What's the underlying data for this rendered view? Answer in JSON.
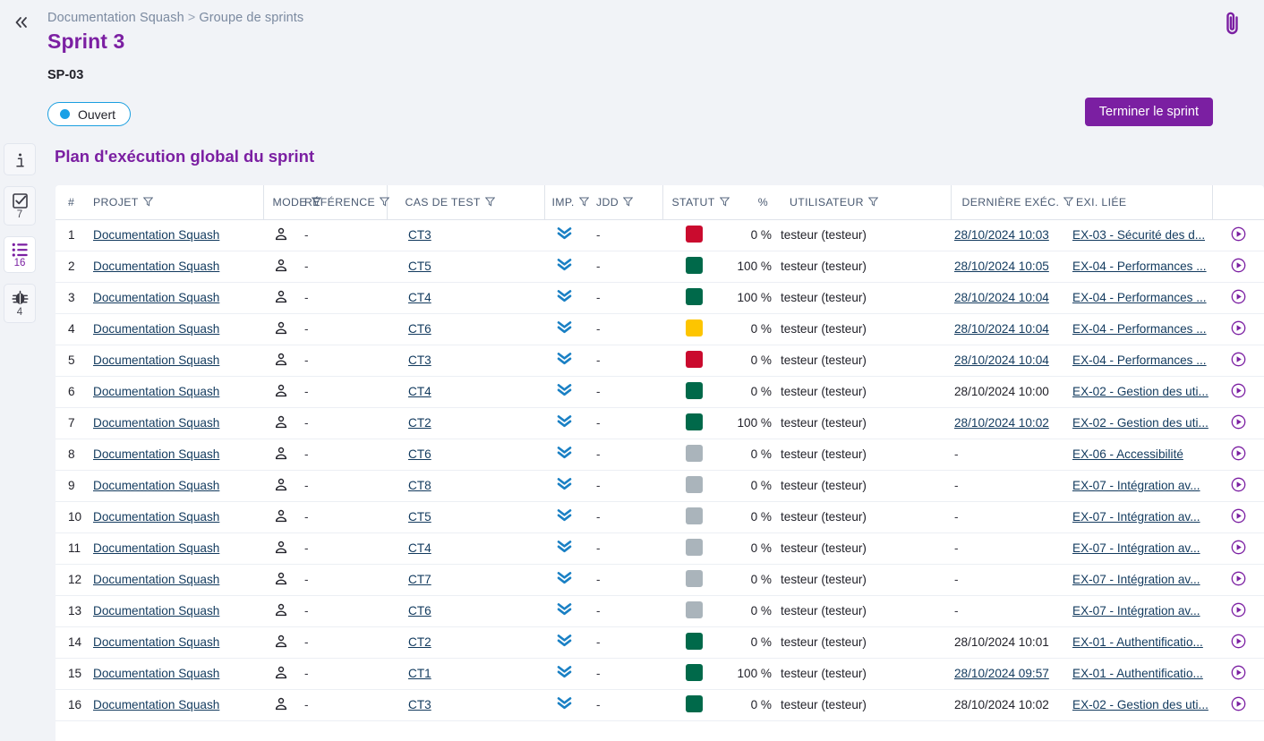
{
  "header": {
    "collapse_icon": "chevron-double-left-icon",
    "attachment_icon": "paperclip-icon",
    "breadcrumb_root": "Documentation Squash",
    "breadcrumb_separator": ">",
    "breadcrumb_leaf": "Groupe de sprints",
    "title": "Sprint 3",
    "reference": "SP-03",
    "status_label": "Ouvert",
    "status_color": "#1aa0e6",
    "primary_button": "Terminer le sprint",
    "primary_color": "#7b1fa2"
  },
  "rail": {
    "items": [
      {
        "name": "info-icon",
        "icon": "info-icon",
        "count": ""
      },
      {
        "name": "checkbox-icon",
        "icon": "check-square-icon",
        "count": "7"
      },
      {
        "name": "list-icon",
        "icon": "list-icon",
        "count": "16",
        "active": true
      },
      {
        "name": "bug-icon",
        "icon": "bug-icon",
        "count": "4"
      }
    ]
  },
  "main": {
    "section_title": "Plan d'exécution global du sprint",
    "columns": [
      {
        "key": "num",
        "label": "#",
        "filter": false
      },
      {
        "key": "proj",
        "label": "PROJET",
        "filter": true
      },
      {
        "key": "mode",
        "label": "MODE",
        "filter": true
      },
      {
        "key": "ref",
        "label": "RÉFÉRENCE",
        "filter": true
      },
      {
        "key": "ct",
        "label": "CAS DE TEST",
        "filter": true
      },
      {
        "key": "imp",
        "label": "IMP.",
        "filter": true
      },
      {
        "key": "jdd",
        "label": "JDD",
        "filter": true
      },
      {
        "key": "stat",
        "label": "STATUT",
        "filter": true
      },
      {
        "key": "pct",
        "label": "%",
        "filter": false
      },
      {
        "key": "user",
        "label": "UTILISATEUR",
        "filter": true
      },
      {
        "key": "exec",
        "label": "DERNIÈRE EXÉC.",
        "filter": true
      },
      {
        "key": "exi",
        "label": "EXI. LIÉE",
        "filter": false
      }
    ],
    "rows": [
      {
        "num": "1",
        "projet": "Documentation Squash",
        "mode": "manual",
        "reference": "-",
        "cas_de_test": "CT3",
        "importance": "low",
        "jdd": "-",
        "statut": "red",
        "pct": "0 %",
        "utilisateur": "testeur (testeur)",
        "derniere_exec": "28/10/2024 10:03",
        "exec_link": true,
        "exigence": "EX-03 - Sécurité des d...",
        "action": "play"
      },
      {
        "num": "2",
        "projet": "Documentation Squash",
        "mode": "manual",
        "reference": "-",
        "cas_de_test": "CT5",
        "importance": "low",
        "jdd": "-",
        "statut": "green",
        "pct": "100 %",
        "utilisateur": "testeur (testeur)",
        "derniere_exec": "28/10/2024 10:05",
        "exec_link": true,
        "exigence": "EX-04 - Performances ...",
        "action": "play"
      },
      {
        "num": "3",
        "projet": "Documentation Squash",
        "mode": "manual",
        "reference": "-",
        "cas_de_test": "CT4",
        "importance": "low",
        "jdd": "-",
        "statut": "green",
        "pct": "100 %",
        "utilisateur": "testeur (testeur)",
        "derniere_exec": "28/10/2024 10:04",
        "exec_link": true,
        "exigence": "EX-04 - Performances ...",
        "action": "play"
      },
      {
        "num": "4",
        "projet": "Documentation Squash",
        "mode": "manual",
        "reference": "-",
        "cas_de_test": "CT6",
        "importance": "low",
        "jdd": "-",
        "statut": "yellow",
        "pct": "0 %",
        "utilisateur": "testeur (testeur)",
        "derniere_exec": "28/10/2024 10:04",
        "exec_link": true,
        "exigence": "EX-04 - Performances ...",
        "action": "play"
      },
      {
        "num": "5",
        "projet": "Documentation Squash",
        "mode": "manual",
        "reference": "-",
        "cas_de_test": "CT3",
        "importance": "low",
        "jdd": "-",
        "statut": "red",
        "pct": "0 %",
        "utilisateur": "testeur (testeur)",
        "derniere_exec": "28/10/2024 10:04",
        "exec_link": true,
        "exigence": "EX-04 - Performances ...",
        "action": "play"
      },
      {
        "num": "6",
        "projet": "Documentation Squash",
        "mode": "manual",
        "reference": "-",
        "cas_de_test": "CT4",
        "importance": "low",
        "jdd": "-",
        "statut": "green",
        "pct": "0 %",
        "utilisateur": "testeur (testeur)",
        "derniere_exec": "28/10/2024 10:00",
        "exec_link": false,
        "exigence": "EX-02 - Gestion des uti...",
        "action": "play"
      },
      {
        "num": "7",
        "projet": "Documentation Squash",
        "mode": "manual",
        "reference": "-",
        "cas_de_test": "CT2",
        "importance": "low",
        "jdd": "-",
        "statut": "green",
        "pct": "100 %",
        "utilisateur": "testeur (testeur)",
        "derniere_exec": "28/10/2024 10:02",
        "exec_link": true,
        "exigence": "EX-02 - Gestion des uti...",
        "action": "play"
      },
      {
        "num": "8",
        "projet": "Documentation Squash",
        "mode": "manual",
        "reference": "-",
        "cas_de_test": "CT6",
        "importance": "low",
        "jdd": "-",
        "statut": "grey",
        "pct": "0 %",
        "utilisateur": "testeur (testeur)",
        "derniere_exec": "-",
        "exec_link": false,
        "exigence": "EX-06 - Accessibilité",
        "action": "play"
      },
      {
        "num": "9",
        "projet": "Documentation Squash",
        "mode": "manual",
        "reference": "-",
        "cas_de_test": "CT8",
        "importance": "low",
        "jdd": "-",
        "statut": "grey",
        "pct": "0 %",
        "utilisateur": "testeur (testeur)",
        "derniere_exec": "-",
        "exec_link": false,
        "exigence": "EX-07 - Intégration av...",
        "action": "play"
      },
      {
        "num": "10",
        "projet": "Documentation Squash",
        "mode": "manual",
        "reference": "-",
        "cas_de_test": "CT5",
        "importance": "low",
        "jdd": "-",
        "statut": "grey",
        "pct": "0 %",
        "utilisateur": "testeur (testeur)",
        "derniere_exec": "-",
        "exec_link": false,
        "exigence": "EX-07 - Intégration av...",
        "action": "play"
      },
      {
        "num": "11",
        "projet": "Documentation Squash",
        "mode": "manual",
        "reference": "-",
        "cas_de_test": "CT4",
        "importance": "low",
        "jdd": "-",
        "statut": "grey",
        "pct": "0 %",
        "utilisateur": "testeur (testeur)",
        "derniere_exec": "-",
        "exec_link": false,
        "exigence": "EX-07 - Intégration av...",
        "action": "play"
      },
      {
        "num": "12",
        "projet": "Documentation Squash",
        "mode": "manual",
        "reference": "-",
        "cas_de_test": "CT7",
        "importance": "low",
        "jdd": "-",
        "statut": "grey",
        "pct": "0 %",
        "utilisateur": "testeur (testeur)",
        "derniere_exec": "-",
        "exec_link": false,
        "exigence": "EX-07 - Intégration av...",
        "action": "play"
      },
      {
        "num": "13",
        "projet": "Documentation Squash",
        "mode": "manual",
        "reference": "-",
        "cas_de_test": "CT6",
        "importance": "low",
        "jdd": "-",
        "statut": "grey",
        "pct": "0 %",
        "utilisateur": "testeur (testeur)",
        "derniere_exec": "-",
        "exec_link": false,
        "exigence": "EX-07 - Intégration av...",
        "action": "play"
      },
      {
        "num": "14",
        "projet": "Documentation Squash",
        "mode": "manual",
        "reference": "-",
        "cas_de_test": "CT2",
        "importance": "low",
        "jdd": "-",
        "statut": "green",
        "pct": "0 %",
        "utilisateur": "testeur (testeur)",
        "derniere_exec": "28/10/2024 10:01",
        "exec_link": false,
        "exigence": "EX-01 - Authentificatio...",
        "action": "play"
      },
      {
        "num": "15",
        "projet": "Documentation Squash",
        "mode": "manual",
        "reference": "-",
        "cas_de_test": "CT1",
        "importance": "low",
        "jdd": "-",
        "statut": "green",
        "pct": "100 %",
        "utilisateur": "testeur (testeur)",
        "derniere_exec": "28/10/2024 09:57",
        "exec_link": true,
        "exigence": "EX-01 - Authentificatio...",
        "action": "play"
      },
      {
        "num": "16",
        "projet": "Documentation Squash",
        "mode": "manual",
        "reference": "-",
        "cas_de_test": "CT3",
        "importance": "low",
        "jdd": "-",
        "statut": "green",
        "pct": "0 %",
        "utilisateur": "testeur (testeur)",
        "derniere_exec": "28/10/2024 10:02",
        "exec_link": false,
        "exigence": "EX-02 - Gestion des uti...",
        "action": "play"
      }
    ]
  },
  "colors": {
    "purple": "#7b1fa2",
    "blue": "#1aa0e6",
    "status_red": "#ca0b2e",
    "status_green": "#00694a",
    "status_yellow": "#fdc500",
    "status_grey": "#aab4bb",
    "link": "#123a5e",
    "background": "#f1f3f7"
  }
}
